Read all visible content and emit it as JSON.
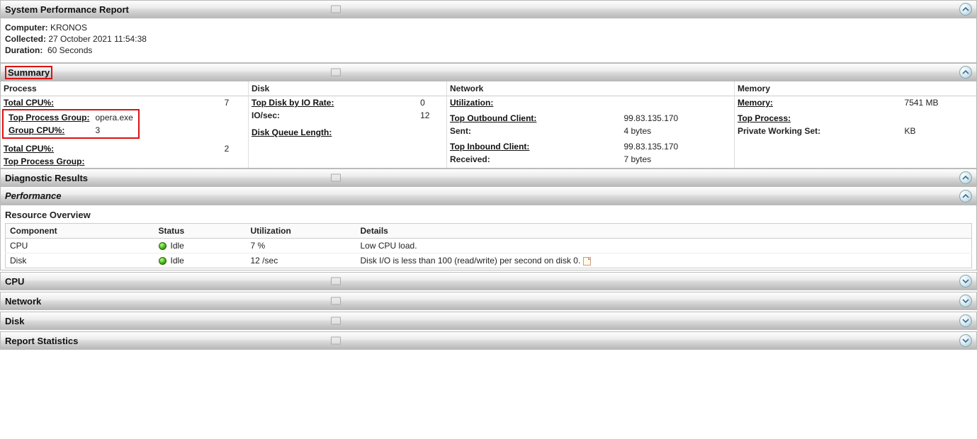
{
  "header": {
    "title": "System Performance Report",
    "meta": {
      "computer_label": "Computer:",
      "computer_value": "KRONOS",
      "collected_label": "Collected:",
      "collected_value": "27 October 2021 11:54:38",
      "duration_label": "Duration:",
      "duration_value": "60 Seconds"
    }
  },
  "summary": {
    "title": "Summary",
    "process": {
      "head": "Process",
      "rows": {
        "total_cpu_label": "Total CPU%:",
        "total_cpu_value": "7",
        "top_group_label": "Top Process Group:",
        "top_group_value": "opera.exe",
        "group_cpu_label": "Group CPU%:",
        "group_cpu_value": "3",
        "total_cpu2_label": "Total CPU%:",
        "total_cpu2_value": "2",
        "top_group2_label": "Top Process Group:"
      }
    },
    "disk": {
      "head": "Disk",
      "rows": {
        "top_disk_label": "Top Disk by IO Rate:",
        "top_disk_value": "0",
        "io_sec_label": "IO/sec:",
        "io_sec_value": "12",
        "queue_label": "Disk Queue Length:"
      }
    },
    "network": {
      "head": "Network",
      "rows": {
        "util_label": "Utilization:",
        "out_client_label": "Top Outbound Client:",
        "out_client_value": "99.83.135.170",
        "sent_label": "Sent:",
        "sent_value": "4 bytes",
        "in_client_label": "Top Inbound Client:",
        "in_client_value": "99.83.135.170",
        "recv_label": "Received:",
        "recv_value": "7 bytes"
      }
    },
    "memory": {
      "head": "Memory",
      "rows": {
        "mem_label": "Memory:",
        "mem_value": "7541 MB",
        "top_proc_label": "Top Process:",
        "pws_label": "Private Working Set:",
        "pws_value": "KB"
      }
    }
  },
  "diagnostic": {
    "title": "Diagnostic Results"
  },
  "performance": {
    "title": "Performance"
  },
  "resource": {
    "title": "Resource Overview",
    "columns": {
      "c1": "Component",
      "c2": "Status",
      "c3": "Utilization",
      "c4": "Details"
    },
    "rows": [
      {
        "component": "CPU",
        "status": "Idle",
        "util": "7 %",
        "details": "Low CPU load."
      },
      {
        "component": "Disk",
        "status": "Idle",
        "util": "12 /sec",
        "details": "Disk I/O is less than 100 (read/write) per second on disk 0."
      }
    ]
  },
  "cpu": {
    "title": "CPU"
  },
  "net": {
    "title": "Network"
  },
  "disk": {
    "title": "Disk"
  },
  "stats": {
    "title": "Report Statistics"
  }
}
